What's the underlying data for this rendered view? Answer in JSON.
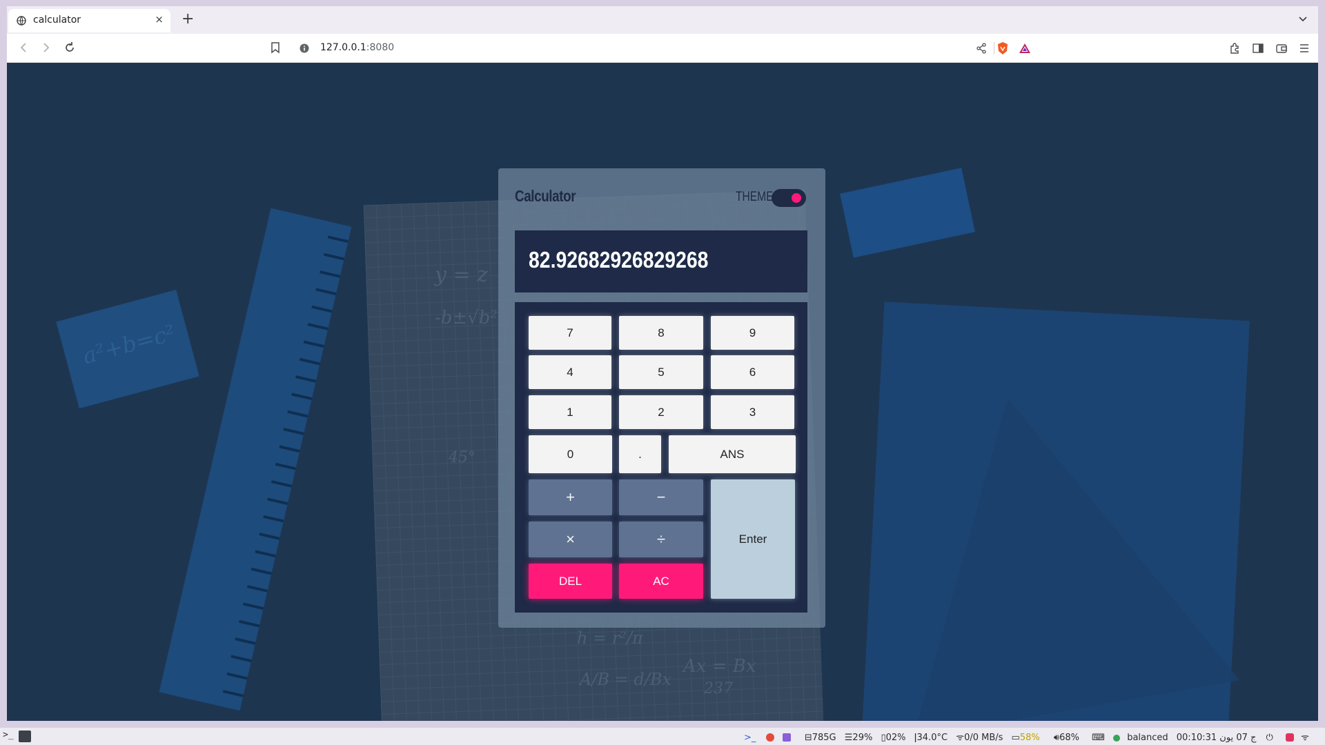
{
  "browser": {
    "tab_title": "calculator",
    "tab_close": "×",
    "new_tab": "+",
    "url_host": "127.0.0.1",
    "url_port": ":8080"
  },
  "calculator": {
    "title": "Calculator",
    "theme_label": "THEME",
    "display_value": "82.92682926829268",
    "keys": {
      "seven": "7",
      "eight": "8",
      "nine": "9",
      "four": "4",
      "five": "5",
      "six": "6",
      "one": "1",
      "two": "2",
      "three": "3",
      "zero": "0",
      "dot": ".",
      "ans": "ANS",
      "plus": "+",
      "minus": "−",
      "times": "×",
      "divide": "÷",
      "del": "DEL",
      "ac": "AC",
      "enter": "Enter"
    },
    "colors": {
      "accent": "#ff1a7a",
      "panel": "#1e2a47",
      "operator": "#5f7291",
      "enter": "#bccfdd"
    }
  },
  "background_math": {
    "sticky": "a²+b=c²",
    "eq1": "y = z",
    "eq2": "-b±√b²",
    "eq3": "h = r²/π",
    "eq4": "Ax = Bx",
    "eq5": "237",
    "eq6": "A/B = d/Bx",
    "eq7": "45°"
  },
  "taskbar": {
    "terminal": ">_",
    "disk": "785G",
    "mem": "29%",
    "cpu": "02%",
    "temp": "34.0°C",
    "net": "0/0 MB/s",
    "battery": "58%",
    "volume": "68%",
    "power_profile": "balanced",
    "clock": "00:10:31 ج 07 يون"
  }
}
